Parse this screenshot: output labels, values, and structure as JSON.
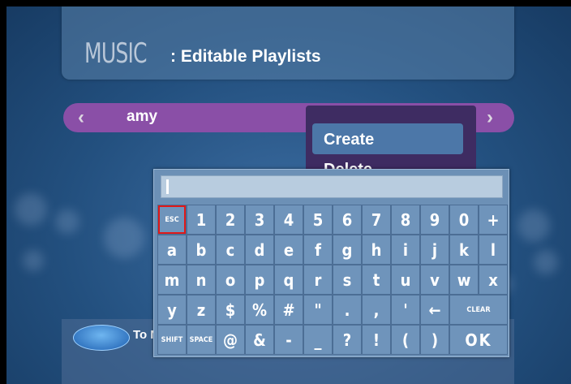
{
  "header": {
    "title_big": "MUSIC",
    "title_sub": ": Editable Playlists"
  },
  "playlist_bar": {
    "left_arrow": "‹",
    "right_arrow": "›",
    "name": "amy"
  },
  "menu": {
    "items": [
      "Create",
      "Delete"
    ],
    "selected": "Create"
  },
  "footer": {
    "text": "To N"
  },
  "keyboard": {
    "input_value": "",
    "rows": [
      [
        "ESC",
        "1",
        "2",
        "3",
        "4",
        "5",
        "6",
        "7",
        "8",
        "9",
        "0",
        "+"
      ],
      [
        "a",
        "b",
        "c",
        "d",
        "e",
        "f",
        "g",
        "h",
        "i",
        "j",
        "k",
        "l"
      ],
      [
        "m",
        "n",
        "o",
        "p",
        "q",
        "r",
        "s",
        "t",
        "u",
        "v",
        "w",
        "x"
      ],
      [
        "y",
        "z",
        "$",
        "%",
        "#",
        "\"",
        ".",
        ",",
        "'",
        "←",
        "CLEAR"
      ],
      [
        "SHIFT",
        "SPACE",
        "@",
        "&",
        "-",
        "_",
        "?",
        "!",
        "(",
        ")",
        "OK"
      ]
    ],
    "selected_key": "ESC"
  },
  "colors": {
    "menu_bg": "#3e2c62",
    "bar": "#8a4fa7",
    "selection": "#e01818"
  }
}
